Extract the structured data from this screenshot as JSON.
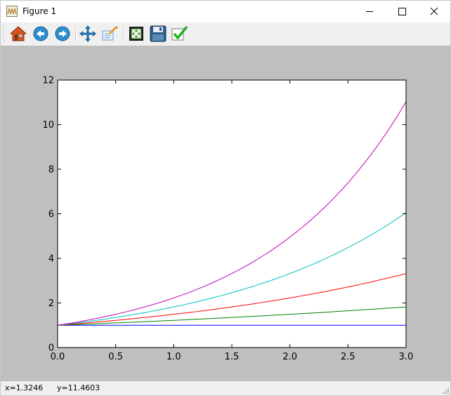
{
  "window": {
    "title": "Figure 1"
  },
  "toolbar": {
    "items": [
      {
        "icon": "home-icon",
        "tooltip": ""
      },
      {
        "icon": "back-icon"
      },
      {
        "icon": "forward-icon"
      },
      {
        "icon": "pan-icon"
      },
      {
        "icon": "zoom-icon"
      },
      {
        "icon": "subplots-icon"
      },
      {
        "icon": "save-icon"
      },
      {
        "icon": "check-icon"
      }
    ]
  },
  "status": {
    "x": "x=1.3246",
    "y": "y=11.4603"
  },
  "chart_data": {
    "type": "line",
    "title": "",
    "xlabel": "",
    "ylabel": "",
    "xlim": [
      0,
      3
    ],
    "ylim": [
      0,
      12
    ],
    "x_ticks": [
      0.0,
      0.5,
      1.0,
      1.5,
      2.0,
      2.5,
      3.0
    ],
    "x_tick_labels": [
      "0.0",
      "0.5",
      "1.0",
      "1.5",
      "2.0",
      "2.5",
      "3.0"
    ],
    "y_ticks": [
      0,
      2,
      4,
      6,
      8,
      10,
      12
    ],
    "y_tick_labels": [
      "0",
      "2",
      "4",
      "6",
      "8",
      "10",
      "12"
    ],
    "grid": false,
    "legend": "none",
    "series": [
      {
        "color": "#0000ff",
        "x": [
          0,
          0.5,
          1.0,
          1.5,
          2.0,
          2.5,
          3.0
        ],
        "y": [
          1.0,
          1.0,
          1.0,
          1.0,
          1.0,
          1.0,
          1.0
        ]
      },
      {
        "color": "#008000",
        "x": [
          0,
          0.5,
          1.0,
          1.5,
          2.0,
          2.5,
          3.0
        ],
        "y": [
          1.0,
          1.105,
          1.221,
          1.35,
          1.492,
          1.649,
          1.822
        ]
      },
      {
        "color": "#ff0000",
        "x": [
          0,
          0.5,
          1.0,
          1.5,
          2.0,
          2.5,
          3.0
        ],
        "y": [
          1.0,
          1.221,
          1.492,
          1.822,
          2.226,
          2.718,
          3.32
        ]
      },
      {
        "color": "#00bfbf",
        "x": [
          0,
          0.5,
          1.0,
          1.5,
          2.0,
          2.5,
          3.0
        ],
        "y": [
          1.0,
          1.35,
          1.822,
          2.46,
          3.32,
          4.482,
          6.05
        ]
      },
      {
        "color": "#bf00bf",
        "x": [
          0,
          0.5,
          1.0,
          1.5,
          2.0,
          2.5,
          3.0
        ],
        "y": [
          1.0,
          1.492,
          2.226,
          3.32,
          4.953,
          7.389,
          11.023
        ]
      }
    ]
  }
}
